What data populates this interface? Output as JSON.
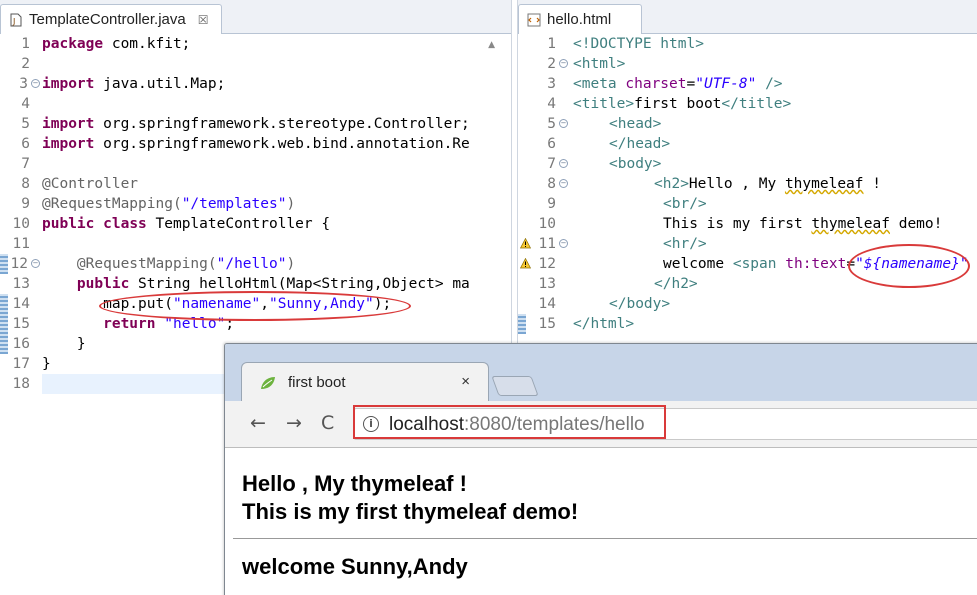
{
  "left_editor": {
    "tab_label": "TemplateController.java",
    "tab_close": "☒",
    "line_numbers": [
      "1",
      "2",
      "3",
      "4",
      "5",
      "6",
      "7",
      "8",
      "9",
      "10",
      "11",
      "12",
      "13",
      "14",
      "15",
      "16",
      "17",
      "18"
    ],
    "lines": [
      [
        "package",
        " com.kfit;"
      ],
      [],
      [
        "import",
        " java.util.Map;"
      ],
      [],
      [
        "import",
        " org.springframework.stereotype.Controller;"
      ],
      [
        "import",
        " org.springframework.web.bind.annotation.Re"
      ],
      [],
      [
        "@Controller"
      ],
      [
        "@RequestMapping(",
        "\"/templates\"",
        ")"
      ],
      [
        "public",
        " ",
        "class",
        " TemplateController {"
      ],
      [],
      [
        "    @RequestMapping(",
        "\"/hello\"",
        ")"
      ],
      [
        "    ",
        "public",
        " String helloHtml(Map<String,Object> ma"
      ],
      [
        "       map.put(",
        "\"namename\"",
        ",",
        "\"Sunny,Andy\"",
        ");"
      ],
      [
        "       ",
        "return",
        " ",
        "\"hello\"",
        ";"
      ],
      [
        "    }"
      ],
      [
        "}"
      ],
      []
    ]
  },
  "right_editor": {
    "tab_label": "hello.html",
    "line_numbers": [
      "1",
      "2",
      "3",
      "4",
      "5",
      "6",
      "7",
      "8",
      "9",
      "10",
      "11",
      "12",
      "13",
      "14",
      "15"
    ],
    "lines": {
      "l1": "<!DOCTYPE html>",
      "l2": "<html>",
      "l3a": "<meta ",
      "l3b": "charset",
      "l3c": "=",
      "l3d": "\"UTF-8\"",
      "l3e": " />",
      "l4a": "<title>",
      "l4b": "first boot",
      "l4c": "</title>",
      "l5": "<head>",
      "l6": "</head>",
      "l7": "<body>",
      "l8a": "<h2>",
      "l8b": "Hello , My ",
      "l8c": "thymeleaf",
      "l8d": " !",
      "l9": "<br/>",
      "l10a": "This is my first ",
      "l10b": "thymeleaf",
      "l10c": " demo!",
      "l11": "<hr/>",
      "l12a": "welcome ",
      "l12b": "<span ",
      "l12c": "th:text",
      "l12d": "=",
      "l12e": "\"${namename}\"",
      "l13": "</h2>",
      "l14": "</body>",
      "l15": "</html>"
    }
  },
  "browser": {
    "tab_title": "first boot",
    "tab_close": "×",
    "url_host": "localhost",
    "url_rest": ":8080/templates/hello",
    "nav_back": "←",
    "nav_forward": "→",
    "nav_reload": "C",
    "page": {
      "heading_line1": "Hello , My thymeleaf !",
      "heading_line2": "This is my first thymeleaf demo!",
      "welcome": "welcome Sunny,Andy"
    }
  },
  "colors": {
    "highlight_oval": "#d93a3a",
    "keyword": "#7f0055",
    "string": "#2a00ff",
    "tag": "#3f7f7f"
  }
}
